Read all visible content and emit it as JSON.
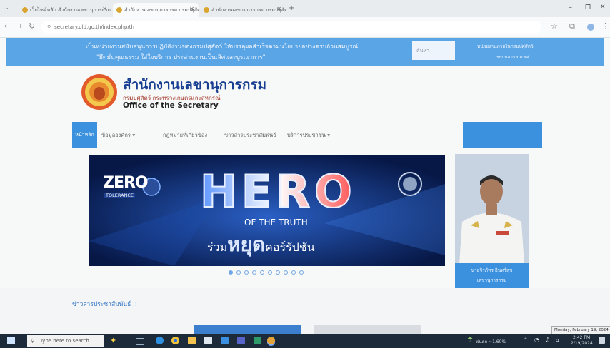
{
  "browser": {
    "tabs": [
      {
        "title": "เว็บไซต์หลัก สำนักงานเลขานุการกรม"
      },
      {
        "title": "สำนักงานเลขานุการกรม กรมปศุสัตว์"
      },
      {
        "title": "สำนักงานเลขานุการกรม กรมปศุสัตว์"
      }
    ],
    "url": "secretary.dld.go.th/index.php/th"
  },
  "banner": {
    "line1": "เป็นหน่วยงานสนับสนุนการปฏิบัติงานของกรมปศุสัตว์ ให้บรรลุผลสำเร็จตามนโยบายอย่างครบถ้วนสมบูรณ์",
    "line2": "\"ยึดมั่นคุณธรรม ใส่ใจบริการ ประสานงานเป็นเลิศและบูรณาการ\"",
    "search_placeholder": "ค้นหา",
    "right_line1": "หน่วยงานภายในกรมปศุสัตว์",
    "right_line2": "ระบบสารสนเทศ"
  },
  "header": {
    "title_th": "สำนักงานเลขานุการกรม",
    "subtitle_th": "กรมปศุสัตว์ กระทรวงเกษตรและสหกรณ์",
    "title_en": "Office of the Secretary"
  },
  "menu": {
    "home": "หน้าหลัก",
    "items": [
      "ข้อมูลองค์กร",
      "กฎหมายที่เกี่ยวข้อง",
      "ข่าวสารประชาสัมพันธ์",
      "บริการประชาชน"
    ]
  },
  "hero": {
    "zero": "ZERO",
    "tolerance": "TOLERANCE",
    "hero_word": "HERO",
    "of_the_truth": "OF THE TRUTH",
    "slogan_prefix": "ร่วม",
    "slogan_main": "หยุด",
    "slogan_suffix": "คอร์รัปชัน",
    "slide_count": 10,
    "active_slide": 0
  },
  "secretary": {
    "name": "นายจิรภัทร อินทร์สุข",
    "position": "เลขานุการกรม"
  },
  "news": {
    "heading": "ข่าวสารประชาสัมพันธ์ ::"
  },
  "taskbar": {
    "search_placeholder": "Type here to search",
    "weather": "ฝนตก ~1.60%",
    "time": "2:42 PM",
    "date": "2/19/2024",
    "tooltip": "Monday, February 19, 2024"
  },
  "colors": {
    "banner_blue": "#5aa5e6",
    "menu_blue": "#3b91de",
    "title_navy": "#173e91",
    "hero_bg": "#0a1f5c"
  }
}
